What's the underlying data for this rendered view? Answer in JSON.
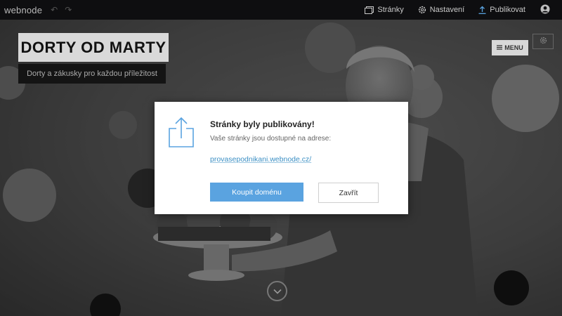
{
  "topbar": {
    "logo": "webnode",
    "nav": {
      "pages_label": "Stránky",
      "settings_label": "Nastavení",
      "publish_label": "Publikovat"
    }
  },
  "site": {
    "title": "DORTY OD MARTY",
    "subtitle": "Dorty a zákusky pro každou příležitost",
    "menu_label": "MENU"
  },
  "dialog": {
    "title": "Stránky byly publikovány!",
    "description": "Vaše stránky jsou dostupné na adrese:",
    "url": "provasepodnikani.webnode.cz/",
    "primary_button": "Koupit doménu",
    "secondary_button": "Zavřít"
  },
  "colors": {
    "accent": "#5aa3e0",
    "link": "#3b8fc4",
    "topbar_bg": "#0e0e10"
  }
}
